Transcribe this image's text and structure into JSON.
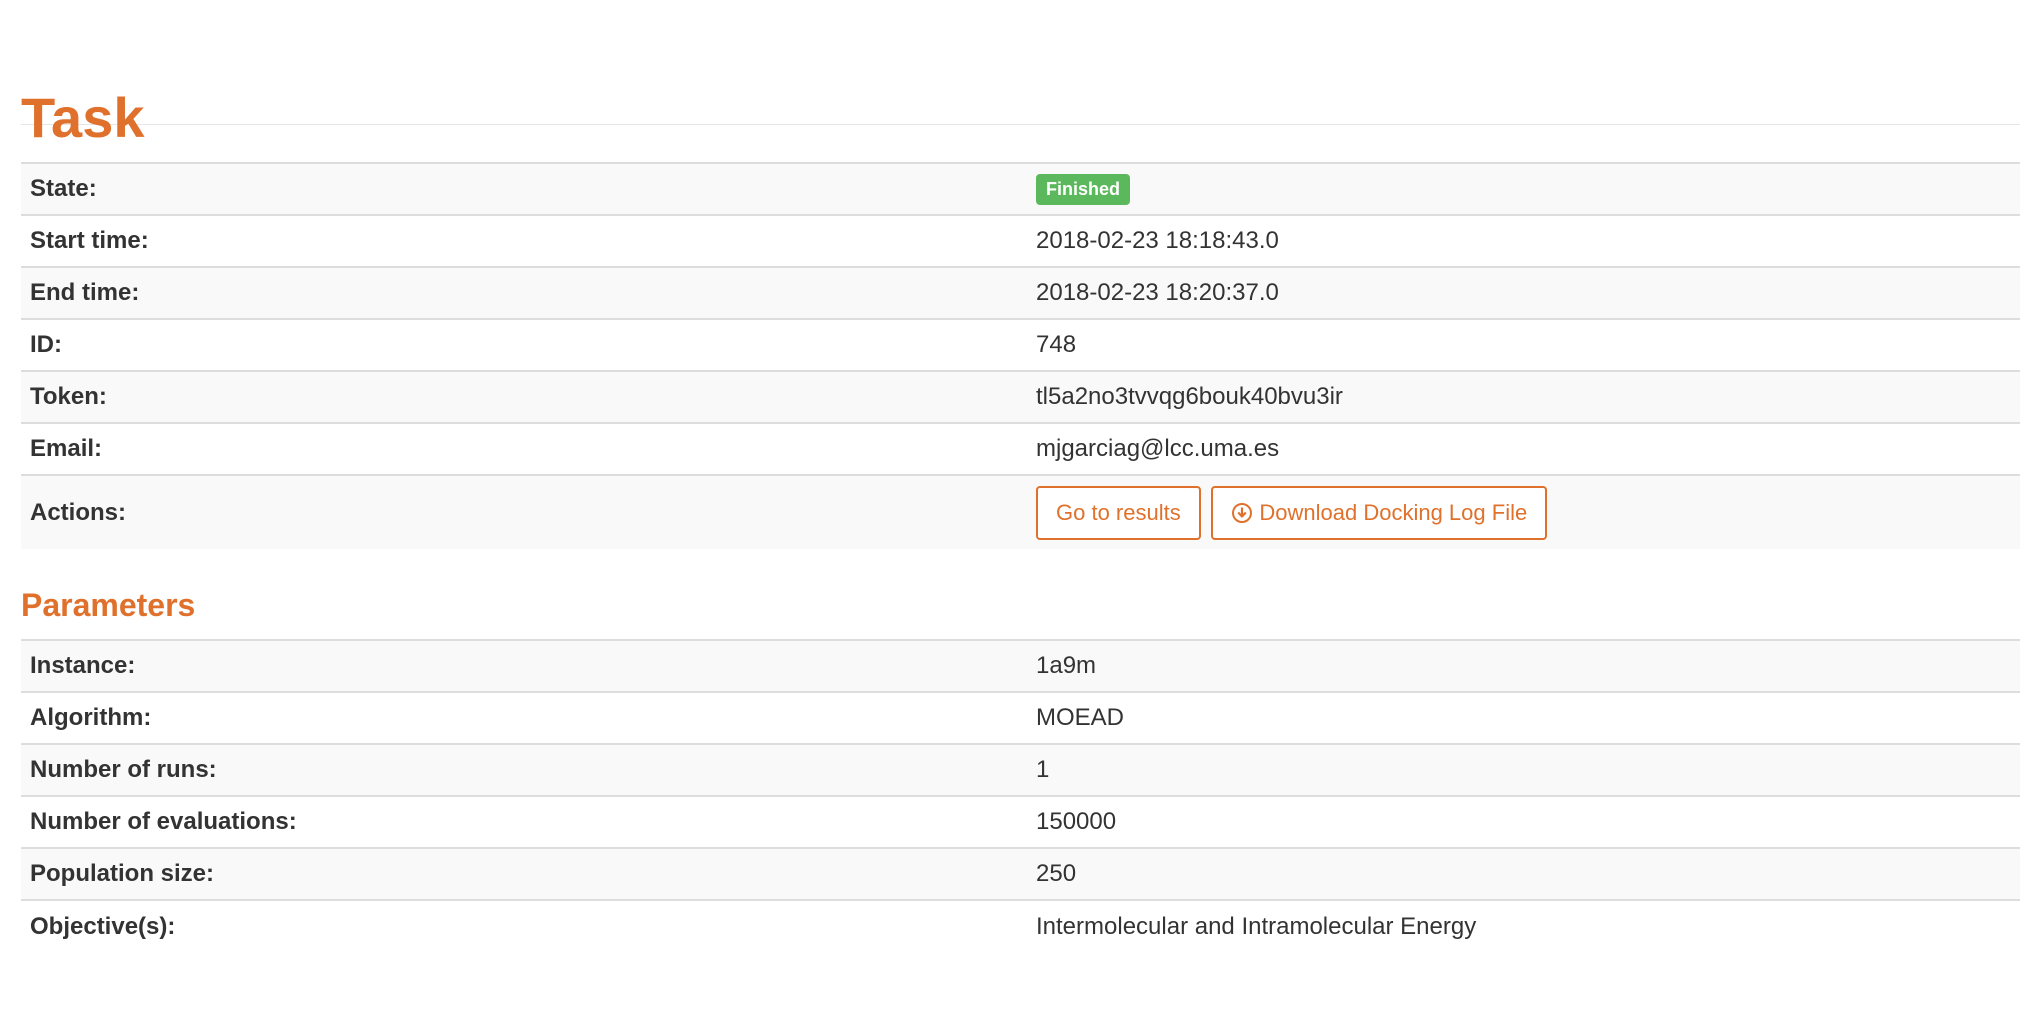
{
  "page": {
    "title": "Task"
  },
  "task": {
    "rows": [
      {
        "label": "State:",
        "badge": "Finished"
      },
      {
        "label": "Start time:",
        "value": "2018-02-23 18:18:43.0"
      },
      {
        "label": "End time:",
        "value": "2018-02-23 18:20:37.0"
      },
      {
        "label": "ID:",
        "value": "748"
      },
      {
        "label": "Token:",
        "value": "tl5a2no3tvvqg6bouk40bvu3ir"
      },
      {
        "label": "Email:",
        "value": "mjgarciag@lcc.uma.es"
      }
    ],
    "actions": {
      "label": "Actions:",
      "results_button": "Go to results",
      "download_button": "Download Docking Log File",
      "download_icon": "download-circle-icon"
    }
  },
  "parameters": {
    "title": "Parameters",
    "rows": [
      {
        "label": "Instance:",
        "value": "1a9m"
      },
      {
        "label": "Algorithm:",
        "value": "MOEAD"
      },
      {
        "label": "Number of runs:",
        "value": "1"
      },
      {
        "label": "Number of evaluations:",
        "value": "150000"
      },
      {
        "label": "Population size:",
        "value": "250"
      },
      {
        "label": "Objective(s):",
        "value": "Intermolecular and Intramolecular Energy"
      }
    ]
  },
  "colors": {
    "accent": "#e0712c",
    "badge_success": "#5cb85c",
    "row_stripe": "#f9f9f9",
    "border": "#dddddd"
  }
}
